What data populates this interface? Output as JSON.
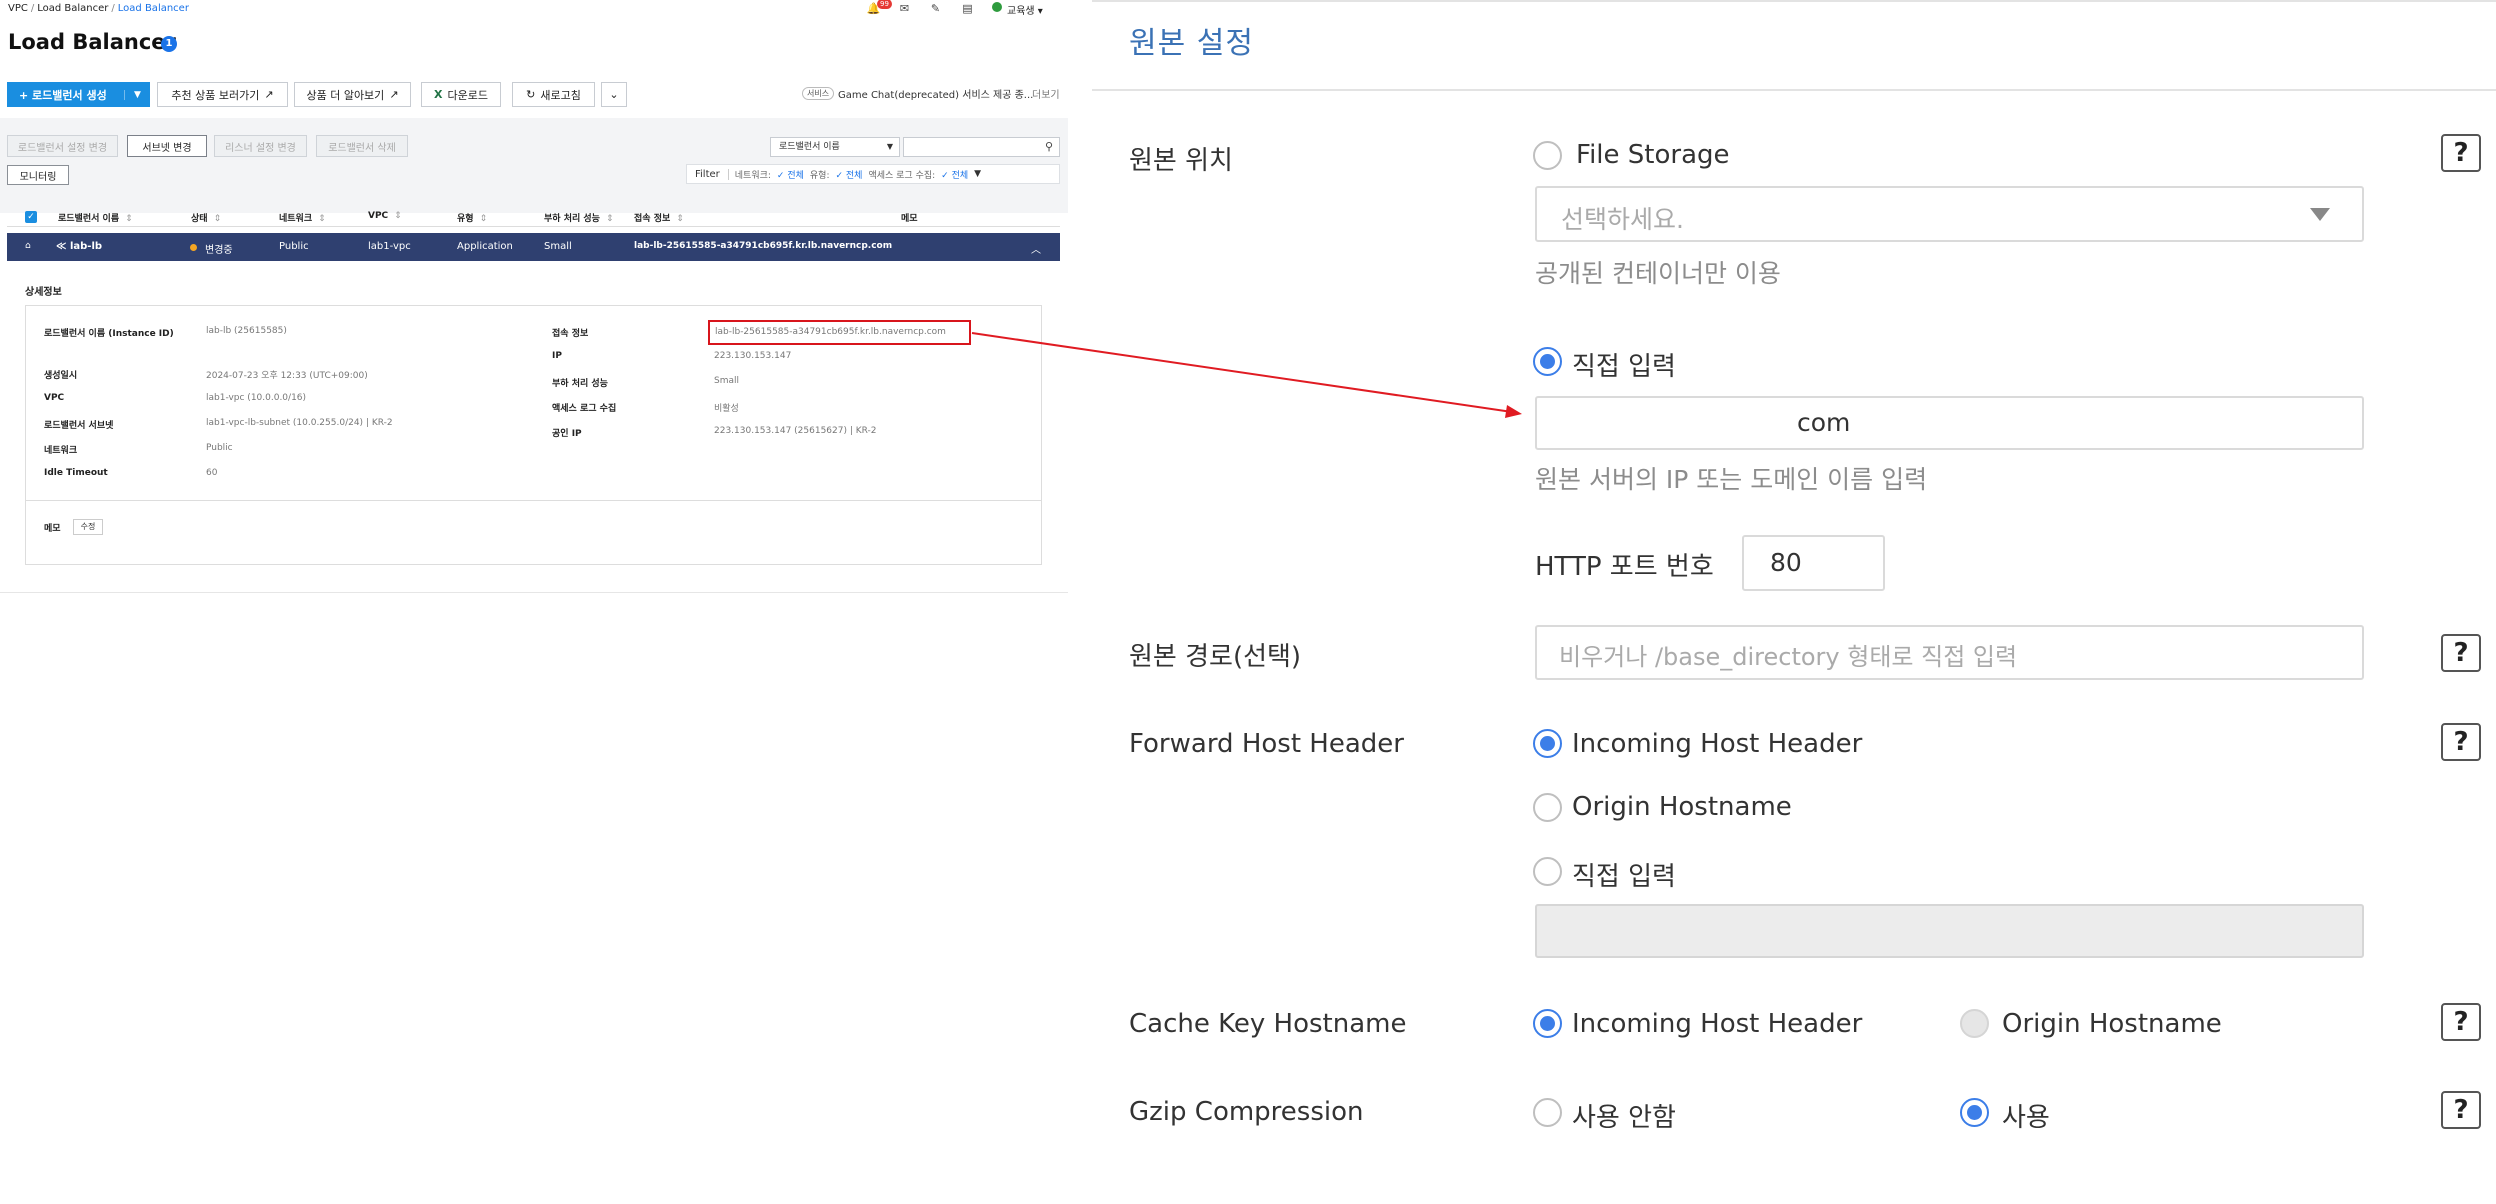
{
  "left": {
    "breadcrumb": {
      "vpc": "VPC",
      "load_balancer": "Load Balancer",
      "current": "Load Balancer"
    },
    "title": "Load Balancer",
    "title_count": "1",
    "header": {
      "notif_count": "99",
      "user": "교육생"
    },
    "toolbar": {
      "create": "로드밸런서 생성",
      "recommend": "추천 상품 보러가기",
      "more_products": "상품 더 알아보기",
      "download": "다운로드",
      "refresh": "새로고침",
      "service_tag": "서비스",
      "service_text": "Game Chat(deprecated) 서비스 제공 종...",
      "more": "더보기"
    },
    "actions": {
      "settings_change": "로드밸런서 설정 변경",
      "subnet_change": "서브넷 변경",
      "listener_change": "리스너 설정 변경",
      "delete": "로드밸런서 삭제",
      "monitoring": "모니터링"
    },
    "search": {
      "select": "로드밸런서 이름"
    },
    "filter": {
      "label": "Filter",
      "network": "네트워크:",
      "network_val": "전체",
      "type": "유형:",
      "type_val": "전체",
      "access_log": "액세스 로그 수집:",
      "access_log_val": "전체"
    },
    "table": {
      "headers": [
        "로드밸런서 이름",
        "상태",
        "네트워크",
        "VPC",
        "유형",
        "부하 처리 성능",
        "접속 정보",
        "메모"
      ],
      "row": {
        "name": "lab-lb",
        "status": "변경중",
        "network": "Public",
        "vpc": "lab1-vpc",
        "type": "Application",
        "perf": "Small",
        "access": "lab-lb-25615585-a34791cb695f.kr.lb.naverncp.com"
      }
    },
    "details": {
      "heading": "상세정보",
      "k_name": "로드밸런서 이름 (Instance ID)",
      "v_name": "lab-lb (25615585)",
      "k_created": "생성일시",
      "v_created": "2024-07-23 오후 12:33 (UTC+09:00)",
      "k_vpc": "VPC",
      "v_vpc": "lab1-vpc (10.0.0.0/16)",
      "k_subnet": "로드밸런서 서브넷",
      "v_subnet": "lab1-vpc-lb-subnet (10.0.255.0/24) | KR-2",
      "k_network": "네트워크",
      "v_network": "Public",
      "k_idle": "Idle Timeout",
      "v_idle": "60",
      "k_access": "접속 정보",
      "v_access": "lab-lb-25615585-a34791cb695f.kr.lb.naverncp.com",
      "k_ip": "IP",
      "v_ip": "223.130.153.147",
      "k_perf": "부하 처리 성능",
      "v_perf": "Small",
      "k_log": "액세스 로그 수집",
      "v_log": "비활성",
      "k_pubip": "공인 IP",
      "v_pubip": "223.130.153.147 (25615627) | KR-2",
      "k_memo": "메모",
      "edit": "수정"
    }
  },
  "right": {
    "title": "원본 설정",
    "origin_location": {
      "label": "원본 위치",
      "file_storage": "File Storage",
      "select_placeholder": "선택하세요.",
      "public_only": "공개된 컨테이너만 이용",
      "direct": "직접 입력",
      "direct_value": "com",
      "direct_hint": "원본 서버의 IP 또는 도메인 이름 입력",
      "http_port_label": "HTTP 포트 번호",
      "http_port": "80"
    },
    "origin_path": {
      "label": "원본 경로(선택)",
      "placeholder": "비우거나 /base_directory 형태로 직접 입력"
    },
    "forward_host": {
      "label": "Forward Host Header",
      "opt1": "Incoming Host Header",
      "opt2": "Origin Hostname",
      "opt3": "직접 입력"
    },
    "cache_key": {
      "label": "Cache Key Hostname",
      "opt1": "Incoming Host Header",
      "opt2": "Origin Hostname"
    },
    "gzip": {
      "label": "Gzip Compression",
      "opt1": "사용 안함",
      "opt2": "사용"
    },
    "help": "?"
  },
  "colors": {
    "accent": "#1a8ee0",
    "selected_row": "#2f4070",
    "highlight": "#d8151c",
    "radio_on": "#3c7ee8",
    "title_blue": "#3b72b5"
  }
}
